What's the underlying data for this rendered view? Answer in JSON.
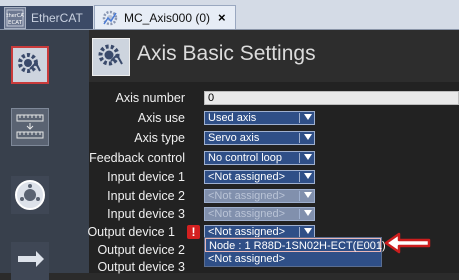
{
  "tabs": [
    {
      "label": "EtherCAT",
      "icon": "ethercat-icon"
    },
    {
      "label": "MC_Axis000 (0)",
      "icon": "axis-gear-icon",
      "close": "×"
    }
  ],
  "ethercat_icon_text": "ECAT",
  "heading": {
    "title": "Axis Basic Settings"
  },
  "rows": [
    {
      "label": "Axis number",
      "value": "0",
      "kind": "text"
    },
    {
      "label": "Axis use",
      "value": "Used axis",
      "kind": "select"
    },
    {
      "label": "Axis type",
      "value": "Servo axis",
      "kind": "select"
    },
    {
      "label": "Feedback control",
      "value": "No control loop",
      "kind": "select"
    },
    {
      "label": "Input device 1",
      "value": "<Not assigned>",
      "kind": "select"
    },
    {
      "label": "Input device 2",
      "value": "<Not assigned>",
      "kind": "select-disabled"
    },
    {
      "label": "Input device 3",
      "value": "<Not assigned>",
      "kind": "select-disabled"
    },
    {
      "label": "Output device 1",
      "value": "<Not assigned>",
      "kind": "select",
      "warning": "!"
    },
    {
      "label": "Output device 2",
      "value": "",
      "kind": "none"
    },
    {
      "label": "Output device 3",
      "value": "",
      "kind": "none"
    }
  ],
  "dropdown": {
    "options": [
      "Node : 1 R88D-1SN02H-ECT(E001)",
      "<Not assigned>"
    ]
  },
  "colors": {
    "accent": "#2f4f87",
    "warning": "#d42020",
    "arrow": "#cc1e1e"
  }
}
